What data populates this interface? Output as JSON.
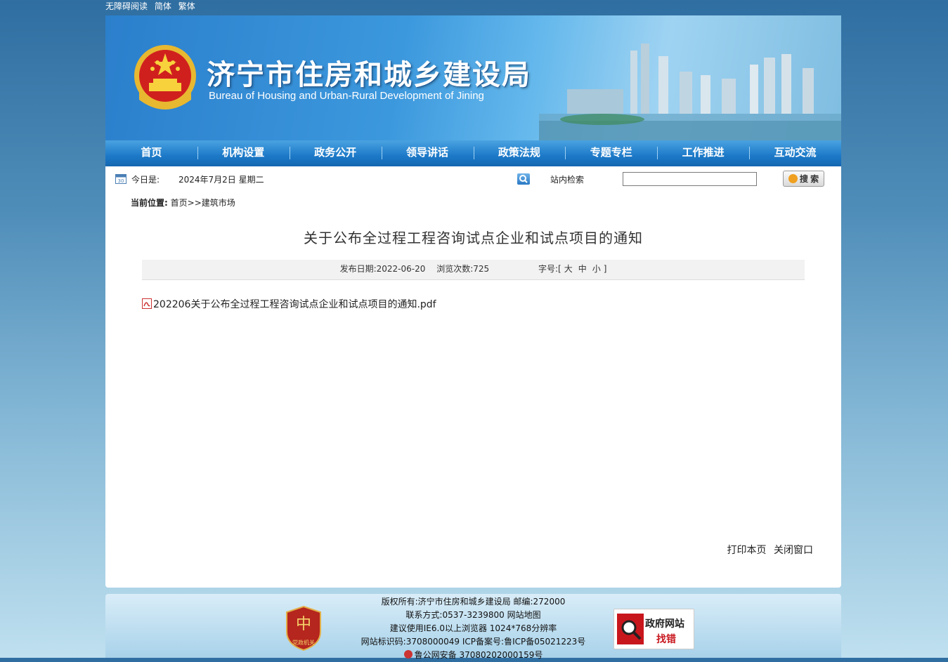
{
  "topbar": {
    "accessibility": "无障碍阅读",
    "simplified": "简体",
    "traditional": "繁体"
  },
  "header": {
    "title_cn": "济宁市住房和城乡建设局",
    "title_en": "Bureau of Housing and Urban-Rural Development of Jining"
  },
  "nav": {
    "items": [
      "首页",
      "机构设置",
      "政务公开",
      "领导讲话",
      "政策法规",
      "专题专栏",
      "工作推进",
      "互动交流"
    ]
  },
  "info": {
    "date_label": "今日是:",
    "date_value": "2024年7月2日  星期二",
    "search_label": "站内检索",
    "search_value": "",
    "search_button": "搜 索"
  },
  "breadcrumb": {
    "label": "当前位置:",
    "home": "首页",
    "sep": ">>",
    "current": "建筑市场"
  },
  "article": {
    "title": "关于公布全过程工程咨询试点企业和试点项目的通知",
    "publish": "发布日期:2022-06-20",
    "views": "浏览次数:725",
    "font_label": "字号:[",
    "font_large": "大",
    "font_medium": "中",
    "font_small": "小",
    "font_end": "]",
    "attachment": "202206关于公布全过程工程咨询试点企业和试点项目的通知.pdf",
    "print": "打印本页",
    "close": "关闭窗口"
  },
  "footer": {
    "line1": "版权所有:济宁市住房和城乡建设局 邮编:272000",
    "line2": "联系方式:0537-3239800 网站地图",
    "line3": "建议使用IE6.0以上浏览器 1024*768分辨率",
    "line4": "网站标识码:3708000049 ICP备案号:鲁ICP备05021223号",
    "line5": "鲁公网安备 37080202000159号",
    "badge_text": "党政机关",
    "find_error_1": "政府网站",
    "find_error_2": "找错"
  },
  "colors": {
    "nav_bg": "#1c79c8",
    "accent_red": "#c8161d",
    "banner_blue": "#2b7fcc"
  }
}
